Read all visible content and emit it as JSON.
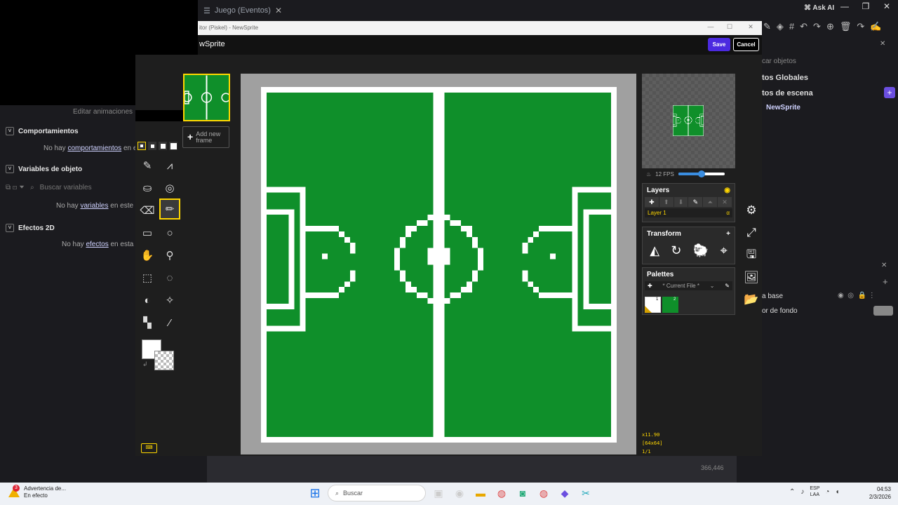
{
  "gdevelop": {
    "tab_label": "Juego (Eventos)",
    "ask_ai": "Ask AI",
    "left": {
      "animations_label": "Editar animaciones",
      "behaviors_title": "Comportamientos",
      "behaviors_empty_pre": "No hay ",
      "behaviors_empty_link": "comportamientos",
      "behaviors_empty_post": " en es",
      "variables_title": "Variables de objeto",
      "search_vars_placeholder": "Buscar variables",
      "vars_empty_pre": "No hay ",
      "vars_empty_link": "variables",
      "vars_empty_post": " en este ol",
      "effects_title": "Efectos 2D",
      "effects_empty_pre": "No hay ",
      "effects_empty_link": "efectos",
      "effects_empty_post": " en esta ca"
    },
    "right": {
      "search_objects": "car objetos",
      "global_objects": "tos Globales",
      "scene_objects": "tos de escena",
      "sprite_item": "NewSprite",
      "layer_base": "a base",
      "background_color": "or de fondo"
    },
    "coords": "366,446"
  },
  "dialog": {
    "window_title": "itor (Piskel) - NewSprite",
    "sprite_name": "wSprite",
    "save": "Save",
    "cancel": "Cancel"
  },
  "piskel": {
    "add_frame": "Add new frame",
    "fps_label": "12 FPS",
    "fps_fraction": 0.5,
    "layers_title": "Layers",
    "layer_name": "Layer 1",
    "layer_opacity_symbol": "α",
    "transform_title": "Transform",
    "palettes_title": "Palettes",
    "palette_select": "* Current File *",
    "palette_colors": [
      "#ffffff",
      "#0f8f2a"
    ],
    "primary_color": "#ffffff",
    "field_green": "#0f8f2a",
    "zoom": "x11.90",
    "size": "[64x64]",
    "frame_count": "1/1"
  },
  "taskbar": {
    "warning_title": "Advertencia de...",
    "warning_sub": "En efecto",
    "warning_badge": "3",
    "search_placeholder": "Buscar",
    "lang_top": "ESP",
    "lang_bottom": "LAA",
    "time": "04:53",
    "date": "2/3/2026"
  }
}
